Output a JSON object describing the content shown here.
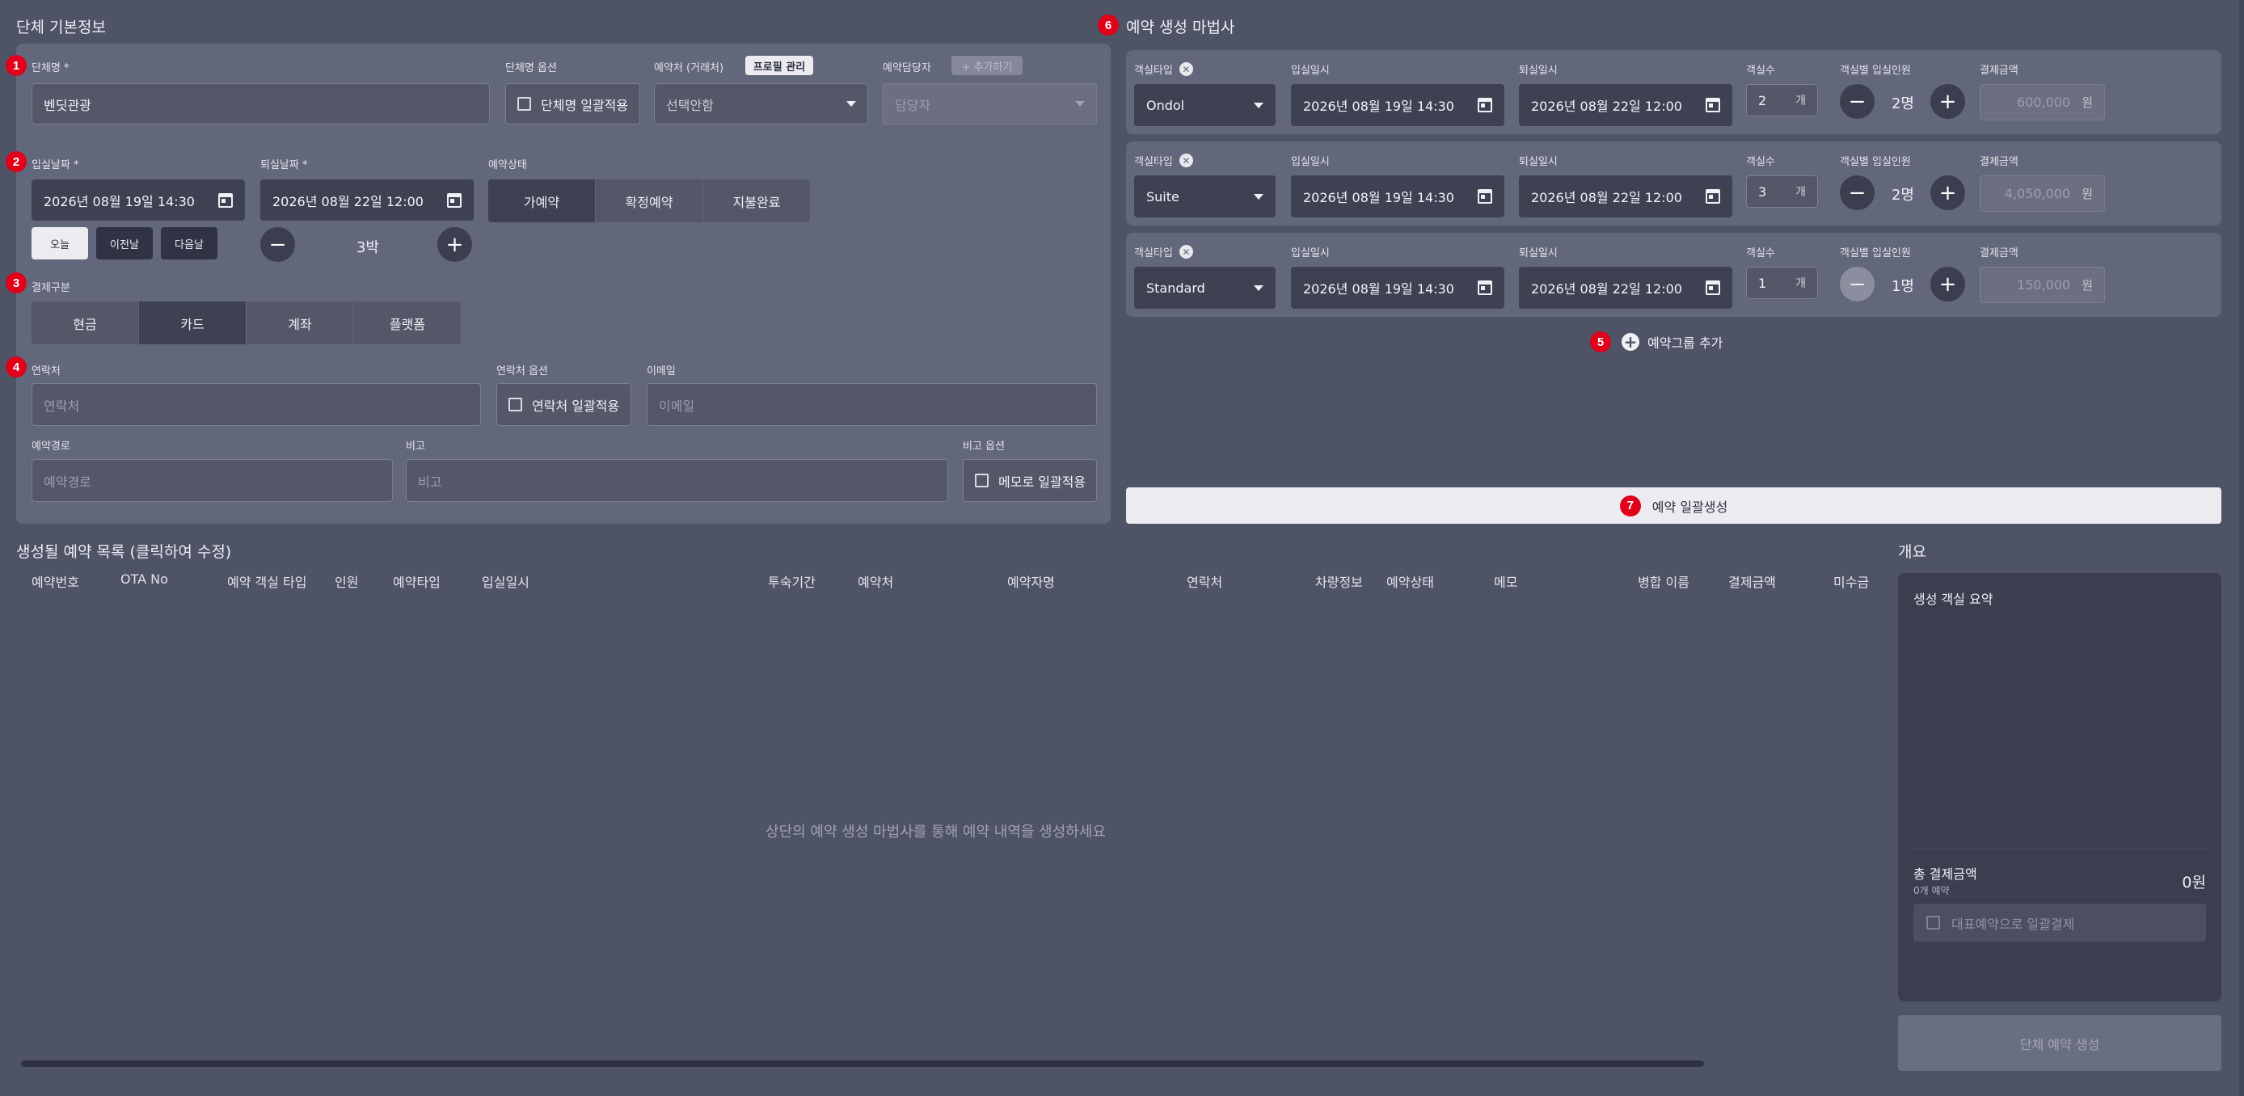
{
  "left": {
    "section_title": "단체 기본정보",
    "group_name_label": "단체명 *",
    "group_name_value": "벤딧관광",
    "group_option_label": "단체명 옵션",
    "group_option_check": "단체명 일괄적용",
    "agency_label": "예약처 (거래처)",
    "program_btn": "프로필 관리",
    "agency_value": "선택안함",
    "manager_label": "예약담당자",
    "add_btn": "+ 추가하기",
    "manager_placeholder": "담당자",
    "checkin_label": "입실날짜 *",
    "checkin_value": "2026년 08월 19일 14:30",
    "checkout_label": "퇴실날짜 *",
    "checkout_value": "2026년 08월 22일 12:00",
    "today_btn": "오늘",
    "prev_btn": "이전날",
    "next_btn": "다음날",
    "nights_value": "3박",
    "status_label": "예약상태",
    "status_options": [
      "가예약",
      "확정예약",
      "지불완료"
    ],
    "payment_label": "결제구분",
    "payment_options": [
      "현금",
      "카드",
      "계좌",
      "플랫폼"
    ],
    "contact_label": "연락처",
    "contact_placeholder": "연락처",
    "contact_option_label": "연락처 옵션",
    "contact_option_check": "연락처 일괄적용",
    "email_label": "이메일",
    "email_placeholder": "이메일",
    "route_label": "예약경로",
    "route_placeholder": "예약경로",
    "memo_label": "비고",
    "memo_placeholder": "비고",
    "memo_option_label": "비고 옵션",
    "memo_option_check": "메모로 일괄적용"
  },
  "wizard": {
    "title": "예약 생성 마법사",
    "labels": {
      "room_type": "객실타입",
      "checkin": "입실일시",
      "checkout": "퇴실일시",
      "rooms": "객실수",
      "guests": "객실별 입실인원",
      "amount": "결제금액"
    },
    "rows": [
      {
        "room_type": "Ondol",
        "checkin": "2026년 08월 19일 14:30",
        "checkout": "2026년 08월 22일 12:00",
        "rooms": "2",
        "rooms_unit": "개",
        "guests": "2명",
        "amount": "600,000",
        "amount_unit": "원"
      },
      {
        "room_type": "Suite",
        "checkin": "2026년 08월 19일 14:30",
        "checkout": "2026년 08월 22일 12:00",
        "rooms": "3",
        "rooms_unit": "개",
        "guests": "2명",
        "amount": "4,050,000",
        "amount_unit": "원"
      },
      {
        "room_type": "Standard",
        "checkin": "2026년 08월 19일 14:30",
        "checkout": "2026년 08월 22일 12:00",
        "rooms": "1",
        "rooms_unit": "개",
        "guests": "1명",
        "amount": "150,000",
        "amount_unit": "원"
      }
    ],
    "add_group": "예약그룹 추가",
    "generate_btn": "예약 일괄생성"
  },
  "list": {
    "title": "생성될 예약 목록 (클릭하여 수정)",
    "columns": [
      "예약번호",
      "OTA No",
      "예약 객실 타입",
      "인원",
      "예약타입",
      "입실일시",
      "투숙기간",
      "예약처",
      "예약자명",
      "연락처",
      "차량정보",
      "예약상태",
      "메모",
      "병합 이름",
      "결제금액",
      "미수금"
    ],
    "empty_text": "상단의 예약 생성 마법사를 통해 예약 내역을 생성하세요"
  },
  "summary": {
    "title": "개요",
    "rooms_summary": "생성 객실 요약",
    "total_label": "총 결제금액",
    "count_text": "0개 예약",
    "total_value": "0원",
    "rep_pay": "대표예약으로 일괄결제",
    "create_btn": "단체 예약 생성"
  },
  "badges": [
    "1",
    "2",
    "3",
    "4",
    "5",
    "6",
    "7"
  ],
  "colors": {
    "background": "#4f5366",
    "panel": "#63677b",
    "dark": "#3d4152",
    "badge": "#e00019"
  }
}
